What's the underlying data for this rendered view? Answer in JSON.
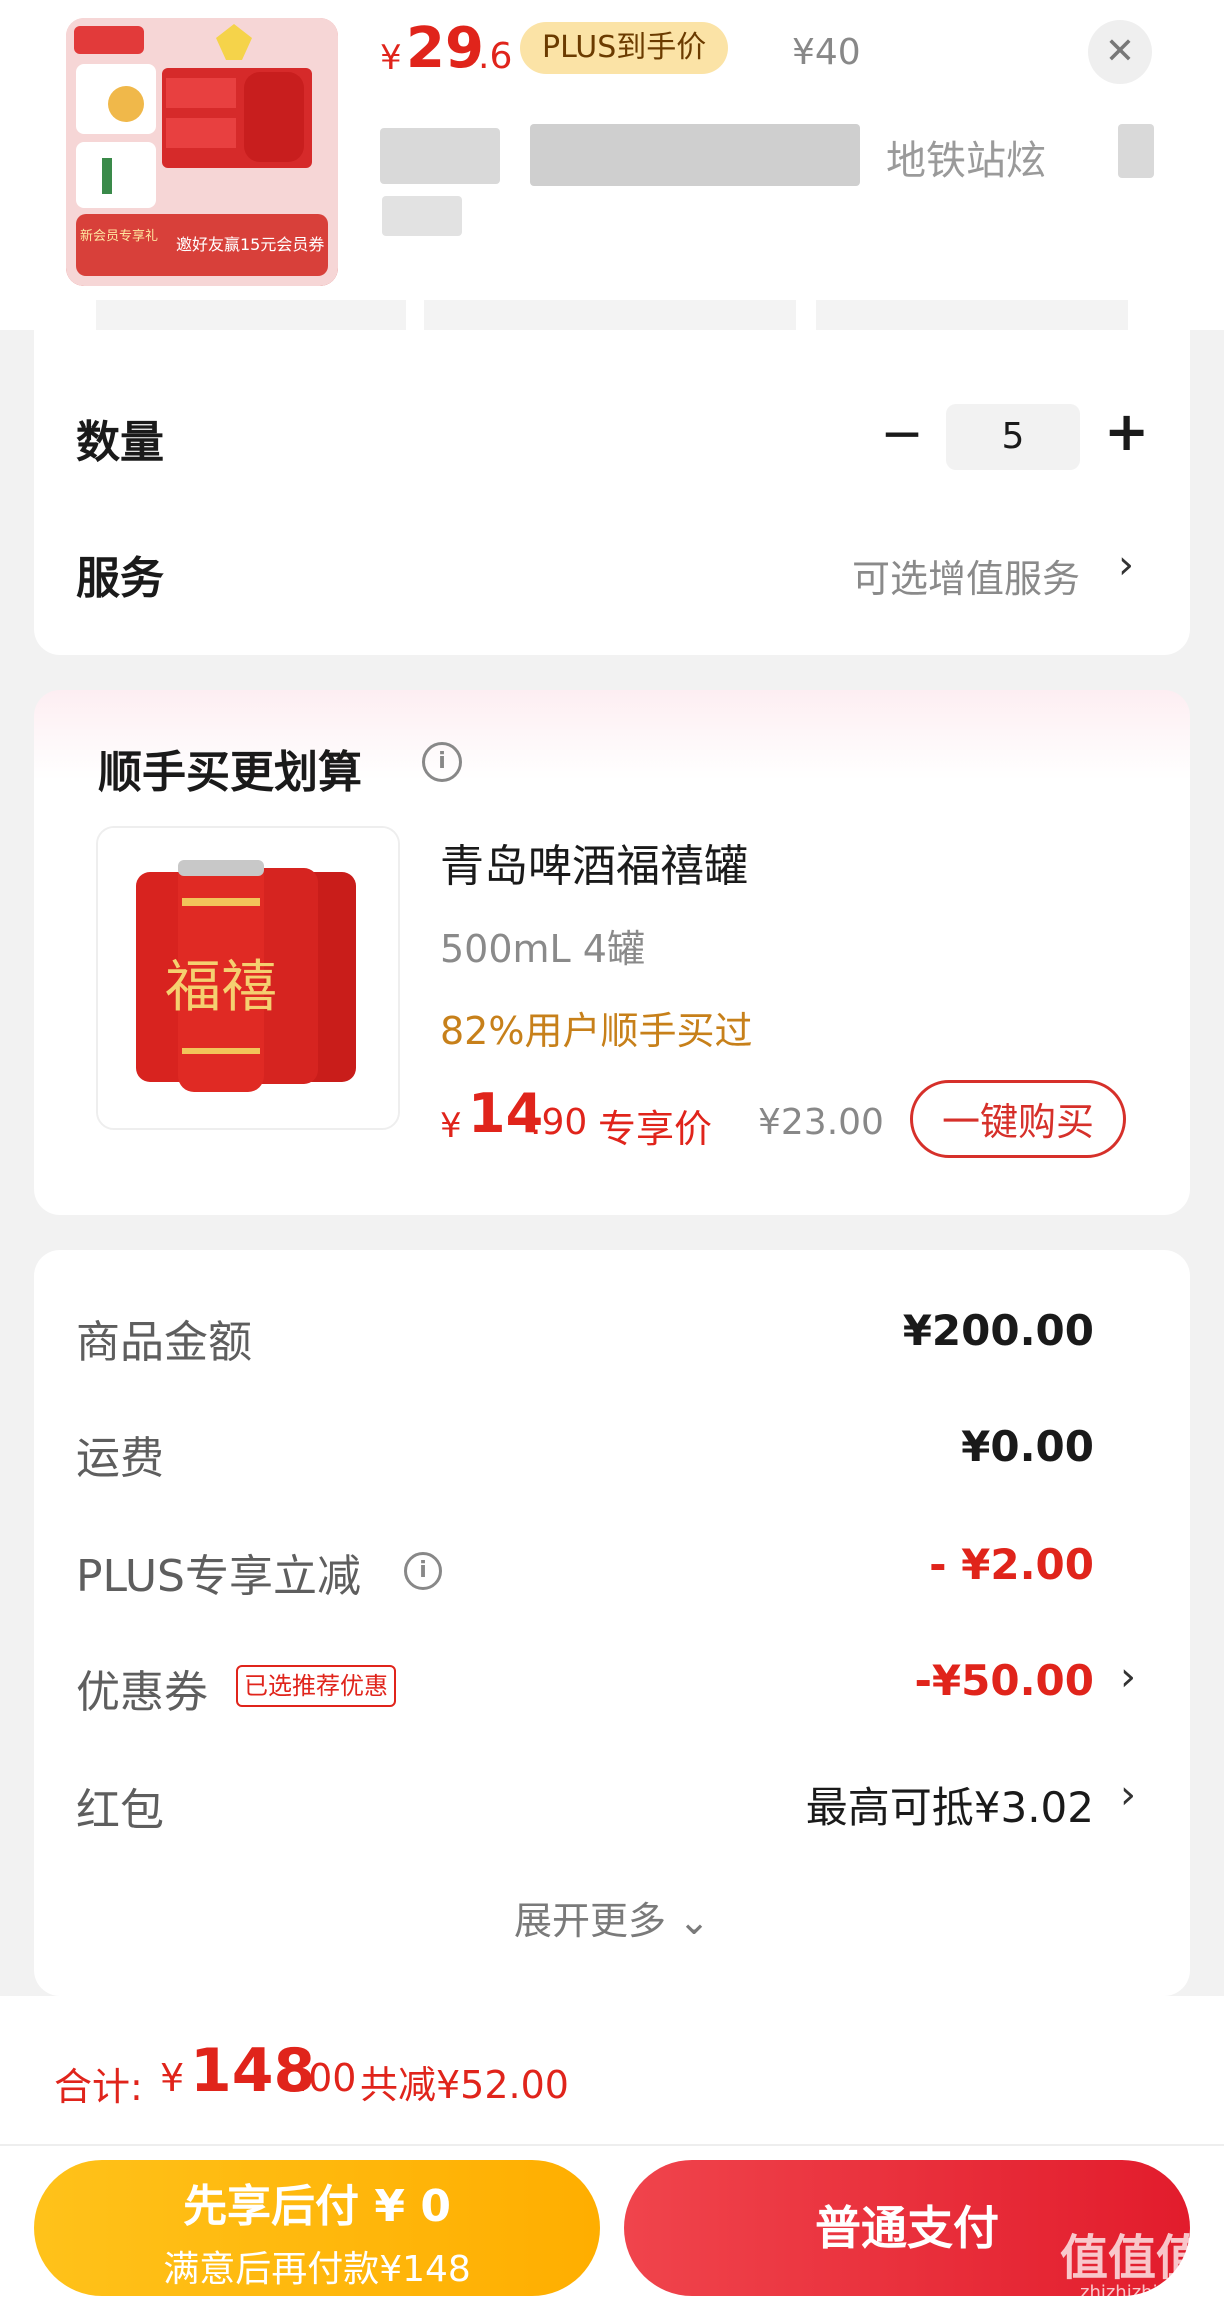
{
  "header": {
    "price_currency": "¥",
    "price_int": "29",
    "price_dec": ".6",
    "plus_badge": "PLUS到手价",
    "original_price": "¥40",
    "title_fragment": "地铁站炫",
    "close_icon": "close-icon",
    "thumbnail": {
      "promo_line": "邀好友赢15元会员券",
      "tag": "新会员专享礼"
    }
  },
  "purchase": {
    "quantity_label": "数量",
    "quantity": "5",
    "minus_symbol": "−",
    "plus_symbol": "+",
    "service_label": "服务",
    "service_value": "可选增值服务",
    "chevron": "›"
  },
  "upsell": {
    "title": "顺手买更划算",
    "product_name": "青岛啤酒福禧罐",
    "spec": "500mL 4罐",
    "social_proof": "82%用户顺手买过",
    "price_currency": "¥",
    "price_int": "14",
    "price_dec": ".90",
    "price_tag": "专享价",
    "original_price": "¥23.00",
    "buy_button": "一键购买",
    "can_glyph": "福禧"
  },
  "summary": {
    "rows": [
      {
        "label": "商品金额",
        "value": "¥200.00"
      },
      {
        "label": "运费",
        "value": "¥0.00"
      },
      {
        "label": "PLUS专享立减",
        "value": "- ¥2.00"
      },
      {
        "label": "优惠券",
        "value": "-¥50.00",
        "tag": "已选推荐优惠"
      },
      {
        "label": "红包",
        "value": "最高可抵¥3.02"
      }
    ],
    "expand": "展开更多 ⌄"
  },
  "footer": {
    "total_label": "合计:",
    "total_currency": "¥",
    "total_int": "148",
    "total_dec": ".00",
    "total_saving": "共减¥52.00",
    "pay_later_main": "先享后付 ¥ 0",
    "pay_later_sub": "满意后再付款¥148",
    "pay_button": "普通支付",
    "watermark": "值值值",
    "watermark_sub": "zhizhizhi.com"
  },
  "colors": {
    "accent_red": "#e0241b",
    "plus_gold": "#fbe3a6",
    "pay_later_yellow": "#ffb800",
    "social_proof_orange": "#c7801a"
  }
}
